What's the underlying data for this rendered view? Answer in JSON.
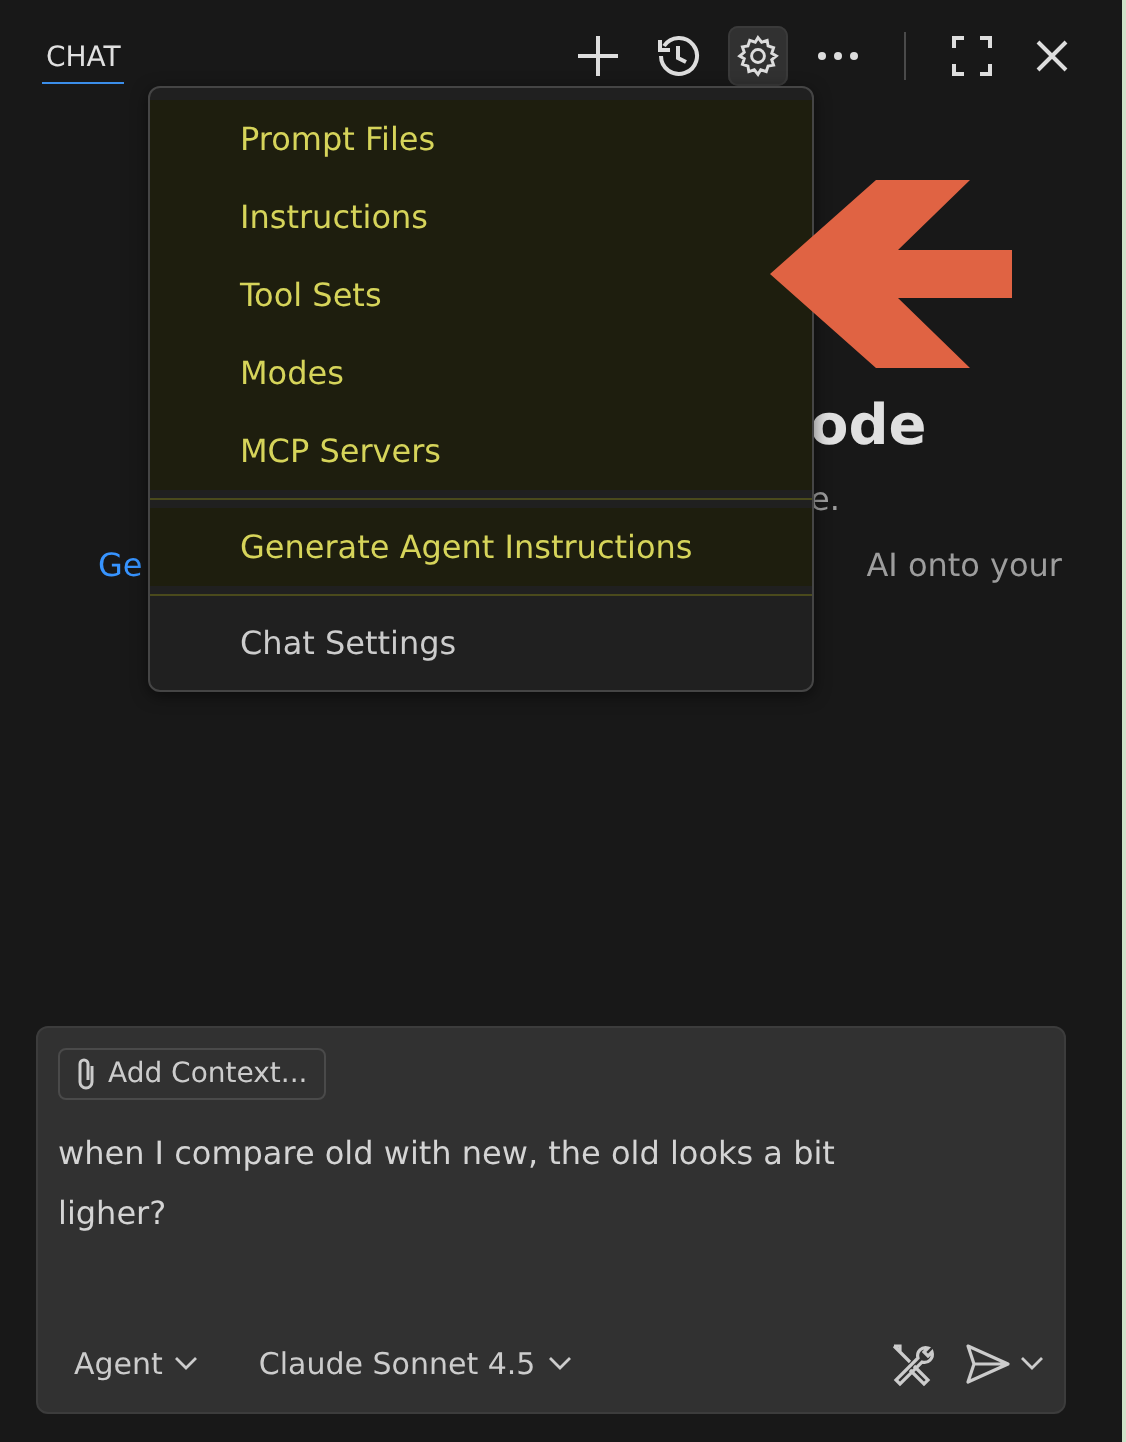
{
  "header": {
    "tab": {
      "label": "CHAT",
      "selected": true
    },
    "actions": [
      {
        "kind": "plus",
        "active": false
      },
      {
        "kind": "history",
        "active": false
      },
      {
        "kind": "gear",
        "active": true
      },
      {
        "kind": "more",
        "active": false
      }
    ],
    "window_actions": [
      {
        "kind": "maximize",
        "active": false
      },
      {
        "kind": "close",
        "active": false
      }
    ]
  },
  "welcome": {
    "heading": "ode",
    "subtitle": "e.",
    "link": "Ge",
    "body": "AI onto your"
  },
  "menu": {
    "groups": [
      {
        "items": [
          {
            "label": "Prompt Files",
            "highlighted": true
          },
          {
            "label": "Instructions",
            "highlighted": true
          },
          {
            "label": "Tool Sets",
            "highlighted": true
          },
          {
            "label": "Modes",
            "highlighted": true
          },
          {
            "label": "MCP Servers",
            "highlighted": true
          }
        ]
      },
      {
        "items": [
          {
            "label": "Generate Agent Instructions",
            "highlighted": true
          }
        ]
      },
      {
        "items": [
          {
            "label": "Chat Settings",
            "highlighted": false
          }
        ]
      }
    ]
  },
  "input": {
    "context_button": "Add Context...",
    "value": "when I compare old with new, the old looks a bit ligher?",
    "mode": "Agent",
    "model": "Claude Sonnet 4.5"
  }
}
